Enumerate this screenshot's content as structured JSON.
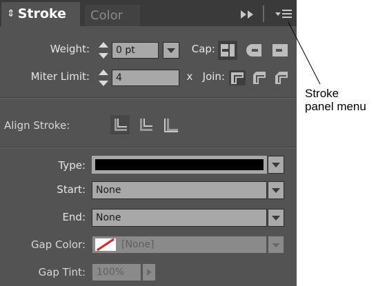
{
  "tabs": [
    {
      "label": "Stroke",
      "active": true
    },
    {
      "label": "Color",
      "active": false
    }
  ],
  "header_icons": [
    "chevron-updown-icon",
    "collapse-arrows-icon",
    "panel-menu-icon"
  ],
  "weight": {
    "label": "Weight:",
    "value": "0 pt"
  },
  "cap": {
    "label": "Cap:"
  },
  "miter": {
    "label": "Miter Limit:",
    "value": "4",
    "unit": "x"
  },
  "join": {
    "label": "Join:"
  },
  "align": {
    "label": "Align Stroke:"
  },
  "type": {
    "label": "Type:",
    "swatch_color": "#000000"
  },
  "start": {
    "label": "Start:",
    "value": "None"
  },
  "end": {
    "label": "End:",
    "value": "None"
  },
  "gap_color": {
    "label": "Gap Color:",
    "value": "[None]"
  },
  "gap_tint": {
    "label": "Gap Tint:",
    "value": "100%"
  },
  "callout": {
    "line1": "Stroke",
    "line2": "panel menu"
  },
  "colors": {
    "panel_bg": "#535353",
    "tabbar_bg": "#3a3a3a",
    "field_bg": "#a8a8a8",
    "accent_red": "#e0201b"
  }
}
